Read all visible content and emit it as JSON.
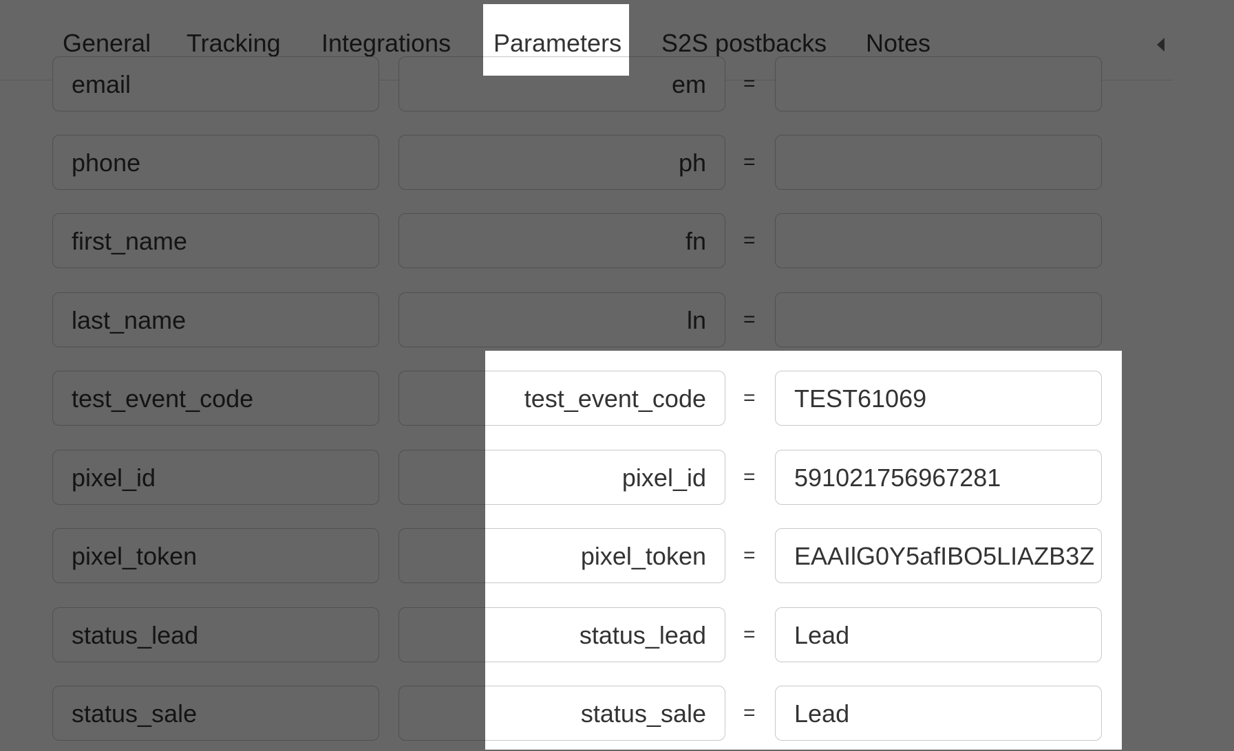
{
  "tabs": [
    {
      "label": "General",
      "active": false
    },
    {
      "label": "Tracking",
      "active": false
    },
    {
      "label": "Integrations",
      "active": false
    },
    {
      "label": "Parameters",
      "active": true
    },
    {
      "label": "S2S postbacks",
      "active": false
    },
    {
      "label": "Notes",
      "active": false
    }
  ],
  "separator": "=",
  "rows": [
    {
      "name": "email",
      "key": "em",
      "value": ""
    },
    {
      "name": "phone",
      "key": "ph",
      "value": ""
    },
    {
      "name": "first_name",
      "key": "fn",
      "value": ""
    },
    {
      "name": "last_name",
      "key": "ln",
      "value": ""
    },
    {
      "name": "test_event_code",
      "key": "test_event_code",
      "value": "TEST61069"
    },
    {
      "name": "pixel_id",
      "key": "pixel_id",
      "value": "591021756967281"
    },
    {
      "name": "pixel_token",
      "key": "pixel_token",
      "value": "EAAIlG0Y5afIBO5LIAZB3Z"
    },
    {
      "name": "status_lead",
      "key": "status_lead",
      "value": "Lead"
    },
    {
      "name": "status_sale",
      "key": "status_sale",
      "value": "Lead"
    }
  ]
}
